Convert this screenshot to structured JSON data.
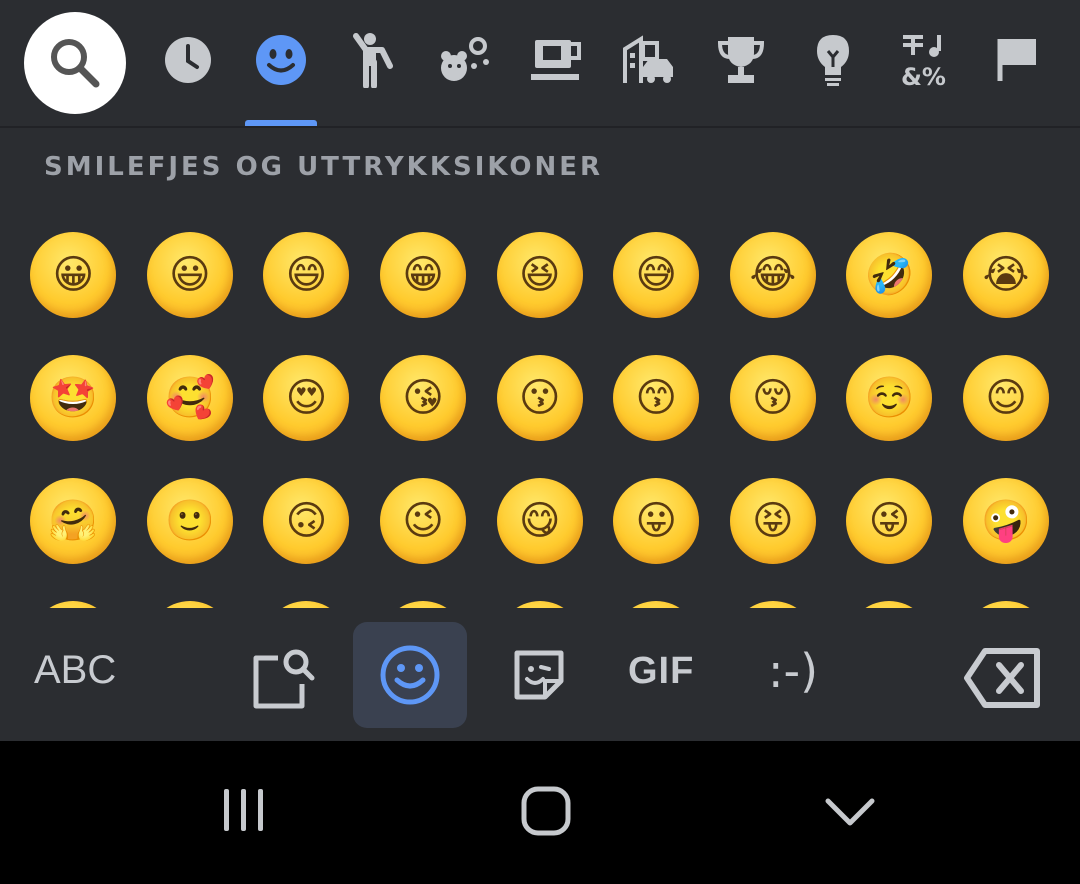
{
  "category_bar": {
    "categories": [
      {
        "name": "search",
        "icon": "search-icon"
      },
      {
        "name": "recent",
        "icon": "clock-icon"
      },
      {
        "name": "smileys",
        "icon": "smiley-icon",
        "active": true
      },
      {
        "name": "people",
        "icon": "person-icon"
      },
      {
        "name": "animals",
        "icon": "animals-nature-icon"
      },
      {
        "name": "food",
        "icon": "coffee-cup-icon"
      },
      {
        "name": "travel",
        "icon": "buildings-car-icon"
      },
      {
        "name": "activities",
        "icon": "trophy-icon"
      },
      {
        "name": "objects",
        "icon": "lightbulb-icon"
      },
      {
        "name": "symbols",
        "icon": "symbols-icon"
      },
      {
        "name": "flags",
        "icon": "flag-icon"
      }
    ],
    "accent_color": "#5e97f6"
  },
  "panel": {
    "section_title": "SMILEFJES OG UTTRYKKSIKONER",
    "emojis": [
      {
        "char": "😀",
        "name": "grinning-face"
      },
      {
        "char": "😃",
        "name": "grinning-face-big-eyes"
      },
      {
        "char": "😄",
        "name": "grinning-face-smiling-eyes"
      },
      {
        "char": "😁",
        "name": "beaming-face"
      },
      {
        "char": "😆",
        "name": "grinning-squinting-face"
      },
      {
        "char": "😅",
        "name": "grinning-face-sweat"
      },
      {
        "char": "😂",
        "name": "face-tears-of-joy"
      },
      {
        "char": "🤣",
        "name": "rolling-on-floor-laughing"
      },
      {
        "char": "😭",
        "name": "loudly-crying-face"
      },
      {
        "char": "🤩",
        "name": "star-struck"
      },
      {
        "char": "🥰",
        "name": "smiling-face-with-hearts"
      },
      {
        "char": "😍",
        "name": "heart-eyes"
      },
      {
        "char": "😘",
        "name": "face-blowing-kiss"
      },
      {
        "char": "😗",
        "name": "kissing-face"
      },
      {
        "char": "😙",
        "name": "kissing-face-smiling-eyes"
      },
      {
        "char": "😚",
        "name": "kissing-face-closed-eyes"
      },
      {
        "char": "☺️",
        "name": "smiling-face"
      },
      {
        "char": "😊",
        "name": "smiling-face-smiling-eyes"
      },
      {
        "char": "🤗",
        "name": "hugging-face"
      },
      {
        "char": "🙂",
        "name": "slightly-smiling-face"
      },
      {
        "char": "🙃",
        "name": "upside-down-face"
      },
      {
        "char": "😉",
        "name": "winking-face"
      },
      {
        "char": "😋",
        "name": "face-savoring-food"
      },
      {
        "char": "😛",
        "name": "face-with-tongue"
      },
      {
        "char": "😝",
        "name": "squinting-face-with-tongue"
      },
      {
        "char": "😜",
        "name": "winking-face-with-tongue"
      },
      {
        "char": "🤪",
        "name": "zany-face"
      }
    ]
  },
  "toolbar": {
    "abc_label": "ABC",
    "gif_label": "GIF",
    "emoticon_label": ":-)",
    "buttons": [
      {
        "name": "abc-button"
      },
      {
        "name": "clipboard-search-button",
        "icon": "clipboard-search-icon"
      },
      {
        "name": "emoji-tab-button",
        "icon": "smiley-icon",
        "active": true
      },
      {
        "name": "sticker-button",
        "icon": "sticker-icon"
      },
      {
        "name": "gif-button"
      },
      {
        "name": "emoticon-button"
      },
      {
        "name": "backspace-button",
        "icon": "backspace-icon"
      }
    ]
  },
  "navbar": {
    "buttons": [
      {
        "name": "recents-button",
        "icon": "recents-icon"
      },
      {
        "name": "home-button",
        "icon": "home-icon"
      },
      {
        "name": "hide-keyboard-button",
        "icon": "chevron-down-icon"
      }
    ]
  }
}
